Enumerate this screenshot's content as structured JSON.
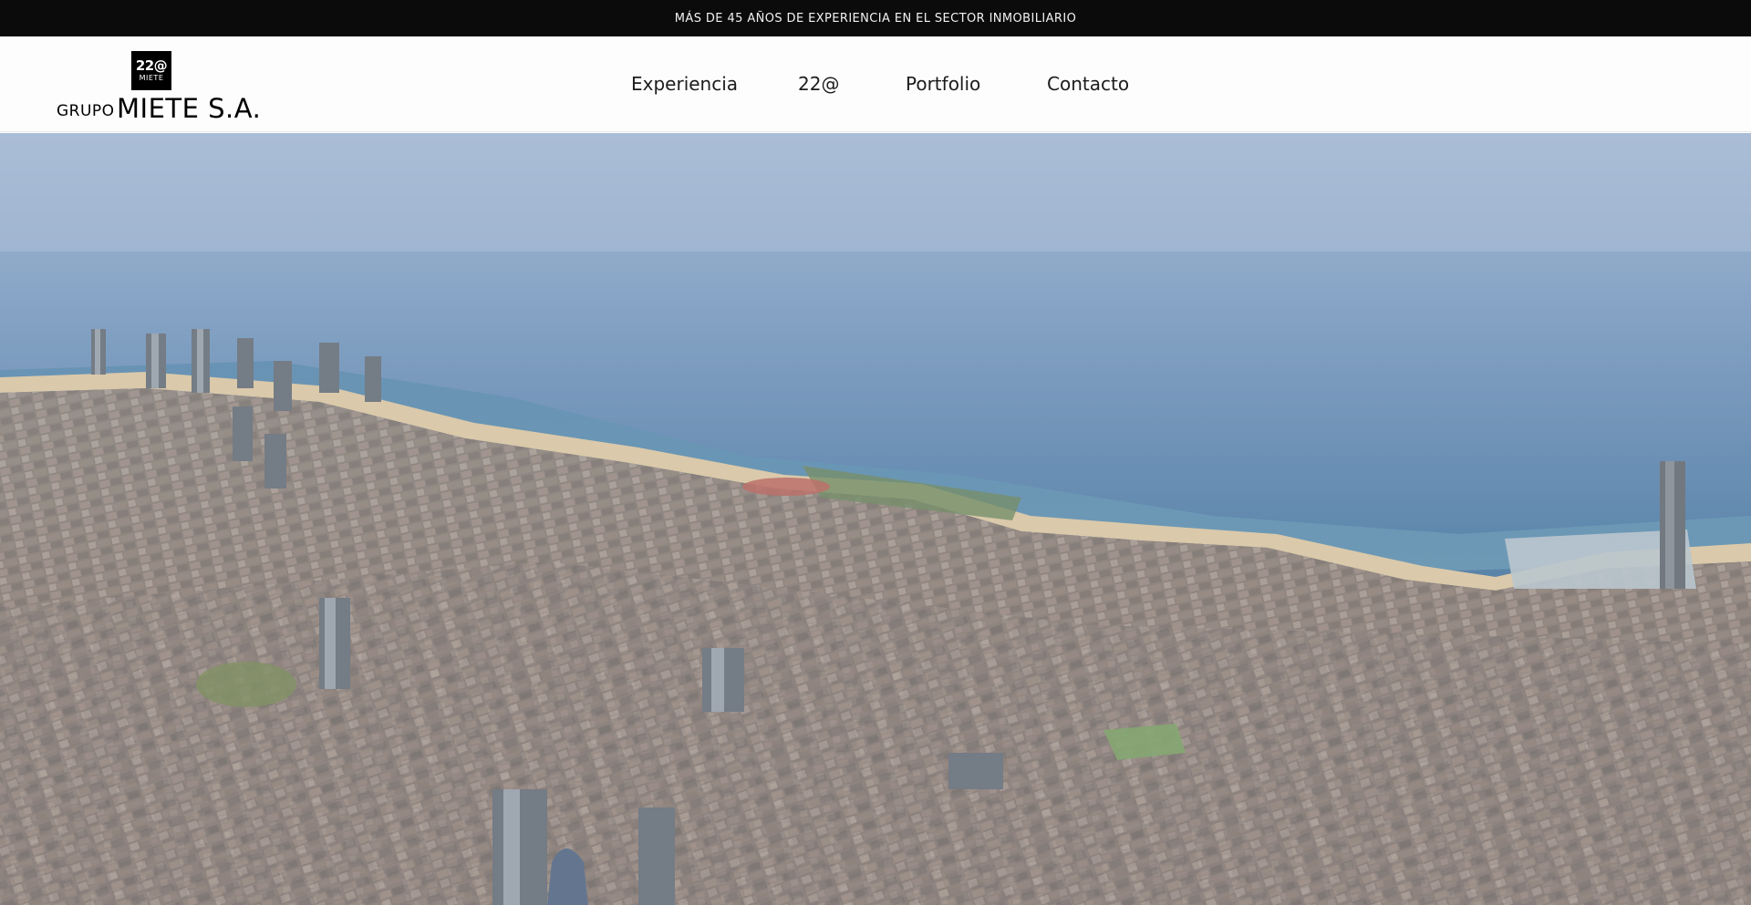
{
  "announcement": {
    "text": "MÁS DE 45 AÑOS DE EXPERIENCIA EN EL SECTOR INMOBILIARIO"
  },
  "logo": {
    "mark_top": "22@",
    "mark_bottom": "MIETE",
    "group": "GRUPO",
    "name": "MIETE S.A."
  },
  "nav": {
    "items": [
      {
        "label": "Experiencia"
      },
      {
        "label": "22@"
      },
      {
        "label": "Portfolio"
      },
      {
        "label": "Contacto"
      }
    ]
  },
  "colors": {
    "topbar": "#0b0b0b",
    "header": "#fdfdfd",
    "sea": "#3f6f95",
    "sky": "#9fb6d3"
  }
}
